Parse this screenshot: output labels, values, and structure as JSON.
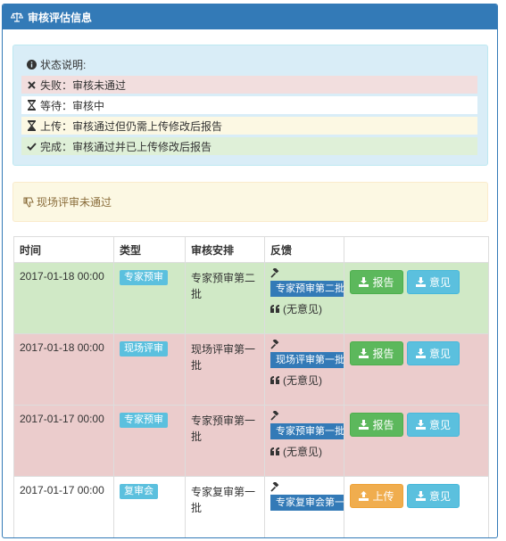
{
  "panel": {
    "title": "审核评估信息"
  },
  "status": {
    "heading": "状态说明:",
    "items": [
      {
        "label": "失败：审核未通过",
        "icon": "times-icon",
        "bg": "#f2dede"
      },
      {
        "label": "等待：审核中",
        "icon": "hourglass-icon",
        "bg": "#ffffff"
      },
      {
        "label": "上传：审核通过但仍需上传修改后报告",
        "icon": "hourglass-half-icon",
        "bg": "#fcf8e3"
      },
      {
        "label": "完成：审核通过并已上传修改后报告",
        "icon": "check-icon",
        "bg": "#dff0d8"
      }
    ]
  },
  "alert": {
    "text": "现场评审未通过",
    "icon": "thumbs-down-icon"
  },
  "table": {
    "headers": [
      "时间",
      "类型",
      "审核安排",
      "反馈",
      ""
    ],
    "rows": [
      {
        "time": "2017-01-18 00:00",
        "type": "专家预审",
        "arrange": "专家预审第二批",
        "batch": "专家预审第二批",
        "note": "(无意见)",
        "status": "success",
        "buttons": [
          "报告",
          "意见"
        ]
      },
      {
        "time": "2017-01-18 00:00",
        "type": "现场评审",
        "arrange": "现场评审第一批",
        "batch": "现场评审第一批",
        "note": "(无意见)",
        "status": "danger",
        "buttons": [
          "报告",
          "意见"
        ]
      },
      {
        "time": "2017-01-17 00:00",
        "type": "专家预审",
        "arrange": "专家预审第一批",
        "batch": "专家预审第一批",
        "note": "(无意见)",
        "status": "danger",
        "buttons": [
          "报告",
          "意见"
        ]
      },
      {
        "time": "2017-01-17 00:00",
        "type": "复审会",
        "arrange": "专家复审第一批",
        "batch": "专家复审会第一批",
        "note": "",
        "status": "plain",
        "buttons": [
          "上传",
          "意见"
        ]
      }
    ]
  },
  "colors": {
    "primary": "#337ab7",
    "success": "#5cb85c",
    "info": "#5bc0de",
    "warning": "#f0ad4e"
  }
}
